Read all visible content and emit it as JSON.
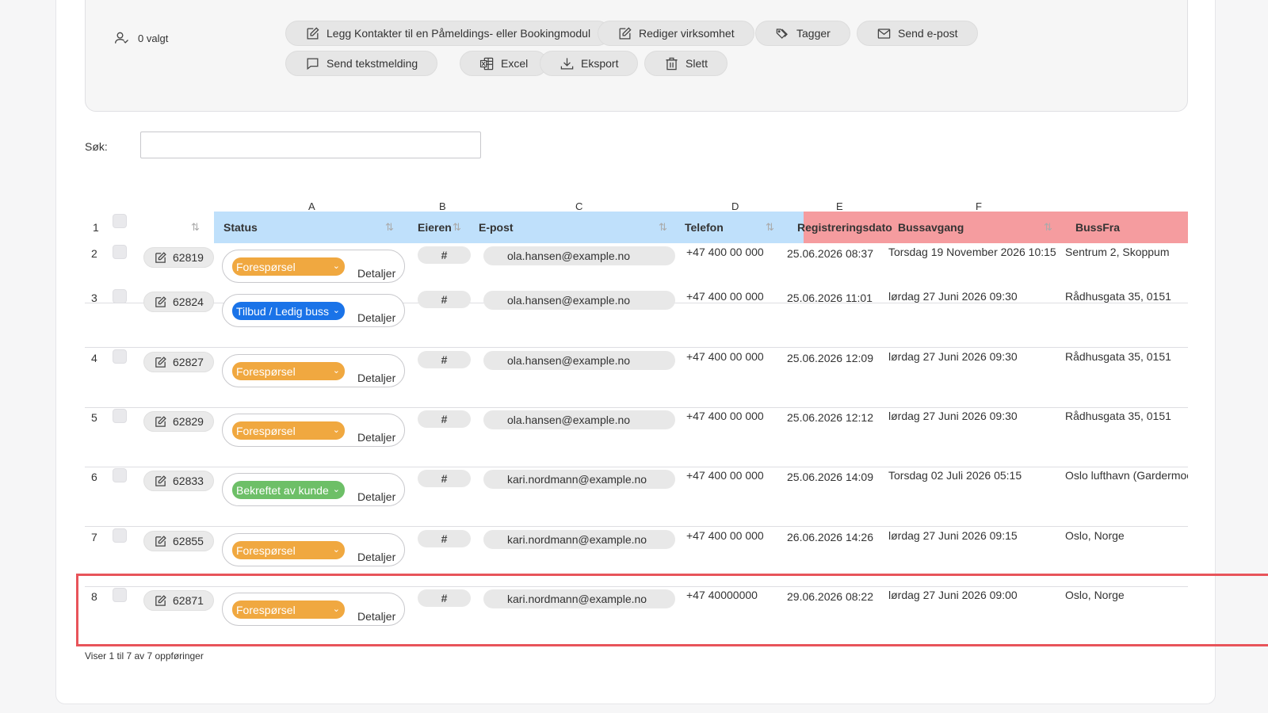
{
  "toolbar": {
    "selected_count": "0 valgt",
    "buttons": {
      "add_contacts": "Legg Kontakter til en Påmeldings- eller Bookingmodul",
      "edit_company": "Rediger virksomhet",
      "tags": "Tagger",
      "send_email": "Send e-post",
      "send_sms": "Send tekstmelding",
      "excel": "Excel",
      "export": "Eksport",
      "delete": "Slett"
    }
  },
  "search": {
    "label": "Søk:",
    "value": ""
  },
  "column_letters": [
    "A",
    "B",
    "C",
    "D",
    "E",
    "F"
  ],
  "header": {
    "row_number": "1",
    "status": "Status",
    "owner": "Eieren",
    "email": "E-post",
    "phone": "Telefon",
    "registered": "Registreringsdato",
    "departure": "Bussavgang",
    "from": "BussFra"
  },
  "rows": [
    {
      "n": "2",
      "id": "62819",
      "status": "Forespørsel",
      "status_color": "#f0a840",
      "details": "Detaljer",
      "owner": "#",
      "email": "ola.hansen@example.no",
      "phone": "+47 400 00 000",
      "registered": "25.06.2026 08:37",
      "departure": "Torsdag 19 November 2026 10:15",
      "from": "Sentrum 2, Skoppum"
    },
    {
      "n": "3",
      "id": "62824",
      "status": "Tilbud / Ledig buss",
      "status_color": "#1a73e8",
      "details": "Detaljer",
      "owner": "#",
      "email": "ola.hansen@example.no",
      "phone": "+47 400 00 000",
      "registered": "25.06.2026 11:01",
      "departure": "lørdag 27 Juni 2026 09:30",
      "from": "Rådhusgata 35, 0151"
    },
    {
      "n": "4",
      "id": "62827",
      "status": "Forespørsel",
      "status_color": "#f0a840",
      "details": "Detaljer",
      "owner": "#",
      "email": "ola.hansen@example.no",
      "phone": "+47 400 00 000",
      "registered": "25.06.2026 12:09",
      "departure": "lørdag 27 Juni 2026 09:30",
      "from": "Rådhusgata 35, 0151"
    },
    {
      "n": "5",
      "id": "62829",
      "status": "Forespørsel",
      "status_color": "#f0a840",
      "details": "Detaljer",
      "owner": "#",
      "email": "ola.hansen@example.no",
      "phone": "+47 400 00 000",
      "registered": "25.06.2026 12:12",
      "departure": "lørdag 27 Juni 2026 09:30",
      "from": "Rådhusgata 35, 0151"
    },
    {
      "n": "6",
      "id": "62833",
      "status": "Bekreftet av kunde",
      "status_color": "#6dbf67",
      "details": "Detaljer",
      "owner": "#",
      "email": "kari.nordmann@example.no",
      "phone": "+47 400 00 000",
      "registered": "25.06.2026 14:09",
      "departure": "Torsdag 02 Juli 2026 05:15",
      "from": "Oslo lufthavn (Gardermoen)"
    },
    {
      "n": "7",
      "id": "62855",
      "status": "Forespørsel",
      "status_color": "#f0a840",
      "details": "Detaljer",
      "owner": "#",
      "email": "kari.nordmann@example.no",
      "phone": "+47 400 00 000",
      "registered": "26.06.2026 14:26",
      "departure": "lørdag 27 Juni 2026 09:15",
      "from": "Oslo, Norge"
    },
    {
      "n": "8",
      "id": "62871",
      "status": "Forespørsel",
      "status_color": "#f0a840",
      "details": "Detaljer",
      "owner": "#",
      "email": "kari.nordmann@example.no",
      "phone": "+47 40000000",
      "registered": "29.06.2026 08:22",
      "departure": "lørdag 27 Juni 2026 09:00",
      "from": "Oslo, Norge"
    }
  ],
  "footer": "Viser 1 til 7 av 7 oppføringer"
}
